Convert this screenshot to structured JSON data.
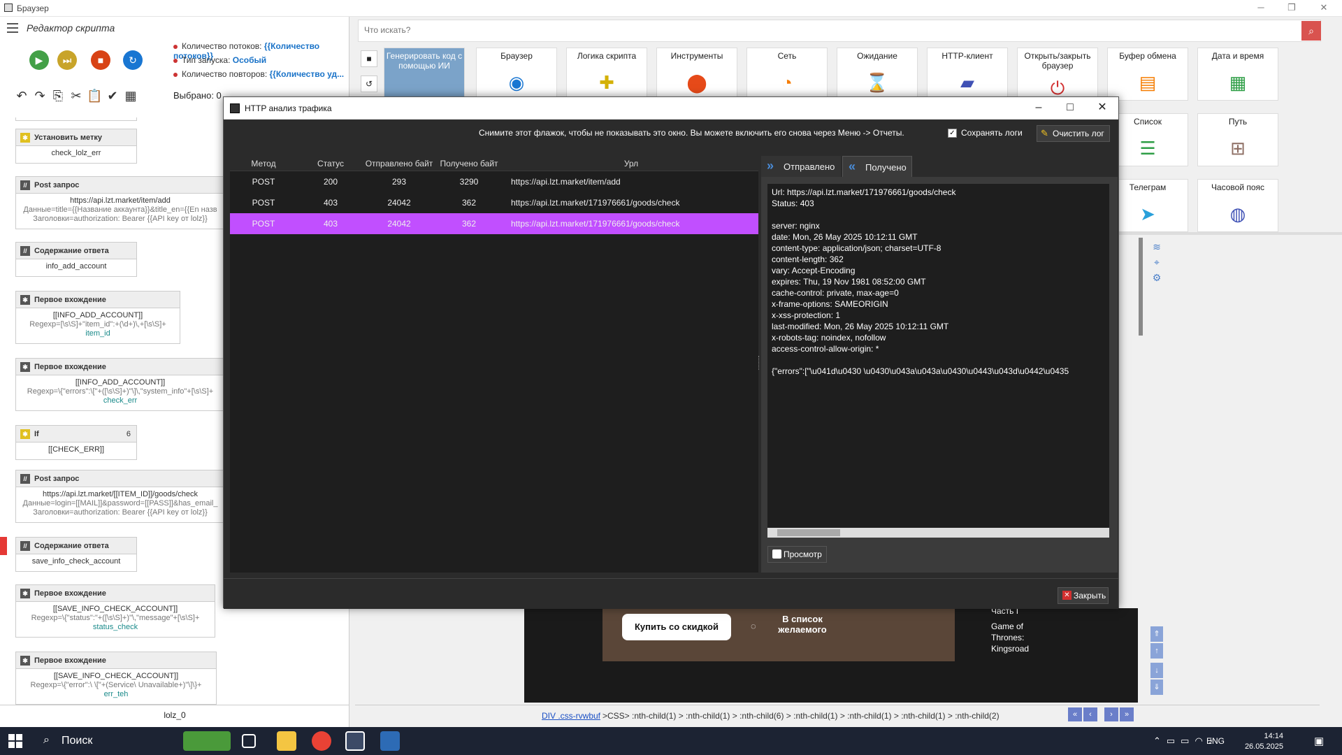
{
  "window": {
    "title": "Браузер"
  },
  "editor": {
    "title": "Редактор скрипта",
    "info": [
      {
        "key": "Количество потоков:",
        "value": "{{Количество потоков}}"
      },
      {
        "key": "Тип запуска:",
        "value": "Особый"
      },
      {
        "key": "Количество повторов:",
        "value": "{{Количество уд..."
      }
    ],
    "selected": "Выбрано:  0",
    "status": "lolz_0",
    "blocks": [
      {
        "title": "Установить метку",
        "lines": [
          "check_lolz_err"
        ]
      },
      {
        "title": "Post запрос",
        "lines": [
          "https://api.lzt.market/item/add",
          "Данные=title={{Название аккаунта}}&title_en={{En назв",
          "Заголовки=authorization: Bearer {{API key от lolz}}"
        ]
      },
      {
        "title": "Содержание ответа",
        "lines": [
          "info_add_account"
        ]
      },
      {
        "title": "Первое вхождение",
        "lines": [
          "[[INFO_ADD_ACCOUNT]]",
          "Regexp=[\\s\\S]+\"item_id\":+(\\d+)\\,+[\\s\\S]+",
          "item_id"
        ]
      },
      {
        "title": "Первое вхождение",
        "lines": [
          "[[INFO_ADD_ACCOUNT]]",
          "Regexp=\\{\"errors\":\\[\"+([\\s\\S]+)\"\\]\\,\"system_info\"+[\\s\\S]+",
          "check_err"
        ]
      },
      {
        "title": "If",
        "count": "6",
        "lines": [
          "[[CHECK_ERR]]"
        ]
      },
      {
        "title": "Post запрос",
        "lines": [
          "https://api.lzt.market/[[ITEM_ID]]/goods/check",
          "Данные=login=[[MAIL]]&password=[[PASS]]&has_email_",
          "Заголовки=authorization: Bearer {{API key от lolz}}"
        ]
      },
      {
        "title": "Содержание ответа",
        "lines": [
          "save_info_check_account"
        ]
      },
      {
        "title": "Первое вхождение",
        "lines": [
          "[[SAVE_INFO_CHECK_ACCOUNT]]",
          "Regexp=\\{\"status\":\"+([\\s\\S]+)\"\\,\"message\"+[\\s\\S]+",
          "status_check"
        ]
      },
      {
        "title": "Первое вхождение",
        "lines": [
          "[[SAVE_INFO_CHECK_ACCOUNT]]",
          "Regexp=\\{\"error\":\\ \\[\"+(Service\\ Unavailable+)\"\\]\\}+",
          "err_teh"
        ]
      }
    ]
  },
  "search": {
    "placeholder": "Что искать?"
  },
  "toolbar": {
    "generate": "Генерировать код с помощью ИИ",
    "items": [
      "Браузер",
      "Логика скрипта",
      "Инструменты",
      "Сеть",
      "Ожидание",
      "HTTP-клиент",
      "Открыть/закрыть браузер",
      "Буфер обмена",
      "Дата и время"
    ],
    "items2": [
      "Список",
      "Путь",
      "Телеграм",
      "Часовой пояс"
    ]
  },
  "web": {
    "buy": "Купить со скидкой",
    "wishlist": "В список желаемого",
    "games": [
      "Часть I",
      "Game of",
      "Thrones:",
      "Kingsroad"
    ]
  },
  "pathbar": {
    "link": "DIV .css-rvwbuf",
    "rest": ">CSS> :nth-child(1) > :nth-child(1) > :nth-child(6) > :nth-child(1) > :nth-child(1) > :nth-child(1) > :nth-child(2)"
  },
  "dialog": {
    "title": "HTTP анализ трафика",
    "notice": "Снимите этот флажок, чтобы не показывать это окно. Вы можете включить его снова через Меню -> Отчеты.",
    "save_logs": "Сохранять логи",
    "clear_log": "Очистить лог",
    "columns": [
      "Метод",
      "Статус",
      "Отправлено байт",
      "Получено байт",
      "Урл"
    ],
    "rows": [
      {
        "method": "POST",
        "status": "200",
        "sent": "293",
        "received": "3290",
        "url": "https://api.lzt.market/item/add"
      },
      {
        "method": "POST",
        "status": "403",
        "sent": "24042",
        "received": "362",
        "url": "https://api.lzt.market/171976661/goods/check"
      },
      {
        "method": "POST",
        "status": "403",
        "sent": "24042",
        "received": "362",
        "url": "https://api.lzt.market/171976661/goods/check"
      }
    ],
    "tab_sent": "Отправлено",
    "tab_received": "Получено",
    "response": "Url: https://api.lzt.market/171976661/goods/check\nStatus: 403\n\nserver: nginx\ndate: Mon, 26 May 2025 10:12:11 GMT\ncontent-type: application/json; charset=UTF-8\ncontent-length: 362\nvary: Accept-Encoding\nexpires: Thu, 19 Nov 1981 08:52:00 GMT\ncache-control: private, max-age=0\nx-frame-options: SAMEORIGIN\nx-xss-protection: 1\nlast-modified: Mon, 26 May 2025 10:12:11 GMT\nx-robots-tag: noindex, nofollow\naccess-control-allow-origin: *\n\n{\"errors\":[\"\\u041d\\u0430 \\u0430\\u043a\\u043a\\u0430\\u0443\\u043d\\u0442\\u0435 ",
    "view": "Просмотр",
    "close": "Закрыть"
  },
  "taskbar": {
    "search": "Поиск",
    "lang": "ENG",
    "time": "14:14",
    "date": "26.05.2025"
  }
}
